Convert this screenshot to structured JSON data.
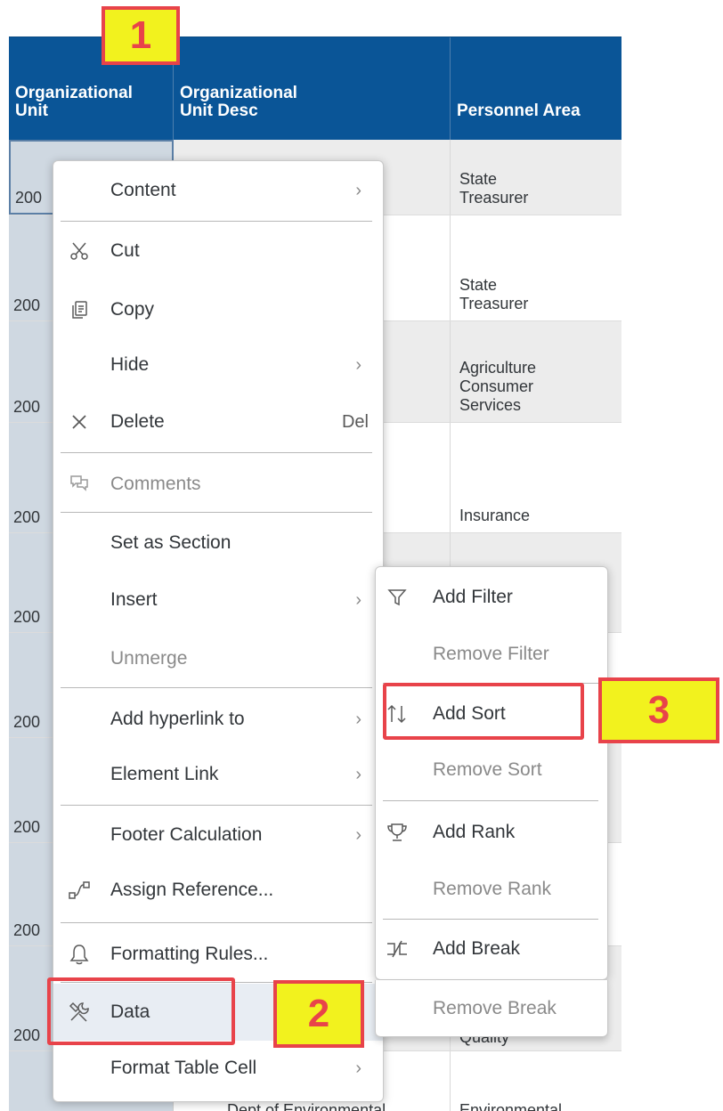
{
  "table": {
    "headers": [
      "Organizational Unit",
      "Organizational Unit Desc",
      "Personnel Area"
    ],
    "rows": [
      {
        "org_unit": "200",
        "personnel_area": "State\nTreasurer"
      },
      {
        "org_unit": "200",
        "personnel_area": "State\nTreasurer"
      },
      {
        "org_unit": "200",
        "personnel_area": "Agriculture\nConsumer\nServices"
      },
      {
        "org_unit": "200",
        "personnel_area": "Insurance"
      },
      {
        "org_unit": "200",
        "personnel_area": ""
      },
      {
        "org_unit": "200",
        "personnel_area": ""
      },
      {
        "org_unit": "200",
        "personnel_area": ""
      },
      {
        "org_unit": "200",
        "personnel_area": ""
      },
      {
        "org_unit": "200",
        "personnel_area": "Quality"
      },
      {
        "org_unit": "",
        "personnel_area": "Environmental",
        "org_unit_desc": "Dept of Environmental"
      }
    ]
  },
  "callouts": {
    "one": "1",
    "two": "2",
    "three": "3"
  },
  "context_menu": {
    "items": [
      {
        "label": "Content",
        "icon": "none",
        "submenu": true
      },
      {
        "label": "Cut",
        "icon": "scissors-icon"
      },
      {
        "label": "Copy",
        "icon": "copy-icon"
      },
      {
        "label": "Hide",
        "icon": "none",
        "submenu": true
      },
      {
        "label": "Delete",
        "icon": "close-icon",
        "shortcut": "Del"
      },
      {
        "label": "Comments",
        "icon": "comments-icon",
        "disabled": true
      },
      {
        "label": "Set as Section",
        "icon": "none"
      },
      {
        "label": "Insert",
        "icon": "none",
        "submenu": true
      },
      {
        "label": "Unmerge",
        "icon": "none",
        "disabled": true
      },
      {
        "label": "Add hyperlink to",
        "icon": "none",
        "submenu": true
      },
      {
        "label": "Element Link",
        "icon": "none",
        "submenu": true
      },
      {
        "label": "Footer Calculation",
        "icon": "none",
        "submenu": true
      },
      {
        "label": "Assign Reference...",
        "icon": "reference-icon"
      },
      {
        "label": "Formatting Rules...",
        "icon": "bell-icon"
      },
      {
        "label": "Data",
        "icon": "tools-icon",
        "submenu": true
      },
      {
        "label": "Format Table Cell",
        "icon": "none",
        "submenu": true
      }
    ]
  },
  "data_submenu": {
    "items": [
      {
        "label": "Add Filter",
        "icon": "filter-icon"
      },
      {
        "label": "Remove Filter",
        "disabled": true
      },
      {
        "label": "Add Sort",
        "icon": "sort-icon"
      },
      {
        "label": "Remove Sort",
        "disabled": true
      },
      {
        "label": "Add Rank",
        "icon": "trophy-icon"
      },
      {
        "label": "Remove Rank",
        "disabled": true
      },
      {
        "label": "Add Break",
        "icon": "break-icon"
      },
      {
        "label": "Remove Break",
        "disabled": true
      }
    ]
  },
  "colors": {
    "header_bg": "#0a5597",
    "callout_fill": "#f2f21e",
    "callout_border": "#e8434a"
  }
}
